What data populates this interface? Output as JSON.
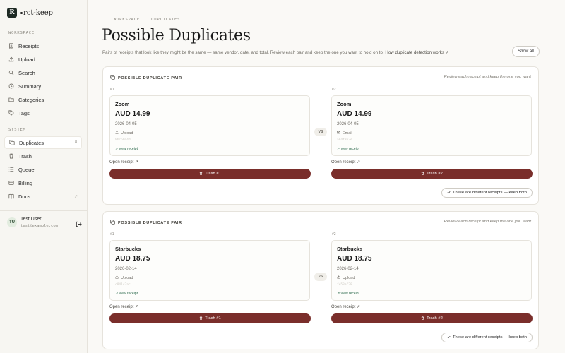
{
  "app": {
    "logo_letter": "R",
    "name": "rct-keep"
  },
  "sidebar": {
    "workspace_label": "WORKSPACE",
    "system_label": "SYSTEM",
    "workspace_items": [
      {
        "label": "Receipts",
        "icon": "receipt-icon"
      },
      {
        "label": "Upload",
        "icon": "upload-icon"
      },
      {
        "label": "Search",
        "icon": "search-icon"
      },
      {
        "label": "Summary",
        "icon": "clock-icon"
      },
      {
        "label": "Categories",
        "icon": "folder-icon"
      },
      {
        "label": "Tags",
        "icon": "tag-icon"
      }
    ],
    "system_items": [
      {
        "label": "Duplicates",
        "icon": "copy-icon",
        "badge": "8",
        "active": true
      },
      {
        "label": "Trash",
        "icon": "trash-icon"
      },
      {
        "label": "Queue",
        "icon": "list-icon"
      },
      {
        "label": "Billing",
        "icon": "card-icon"
      },
      {
        "label": "Docs",
        "icon": "book-icon",
        "external": "↗"
      }
    ],
    "user": {
      "initials": "TU",
      "name": "Test User",
      "email": "test@example.com"
    }
  },
  "breadcrumb": {
    "section": "WORKSPACE",
    "separator": "·",
    "page": "DUPLICATES"
  },
  "page": {
    "title": "Possible Duplicates",
    "description": "Pairs of receipts that look like they might be the same — same vendor, date, and total. Review each pair and keep the one you want to hold on to.",
    "description_link": "How duplicate detection works",
    "show_all": "Show all"
  },
  "pairs": [
    {
      "header": "POSSIBLE DUPLICATE PAIR",
      "hint": "Review each receipt and keep the one you want",
      "vs": "VS",
      "keep_both": "These are different receipts — keep both",
      "left": {
        "index": "#1",
        "vendor": "Zoom",
        "amount": "AUD 14.99",
        "date": "2026-04-05",
        "source": "Upload",
        "hash": "9bc5044d...",
        "view": "↗ view receipt",
        "open": "Open receipt",
        "trash": "Trash #1"
      },
      "right": {
        "index": "#2",
        "vendor": "Zoom",
        "amount": "AUD 14.99",
        "date": "2026-04-05",
        "source": "Email",
        "hash": "a84f3b2e...",
        "view": "↗ view receipt",
        "open": "Open receipt",
        "trash": "Trash #2"
      }
    },
    {
      "header": "POSSIBLE DUPLICATE PAIR",
      "hint": "Review each receipt and keep the one you want",
      "vs": "VS",
      "keep_both": "These are different receipts — keep both",
      "left": {
        "index": "#1",
        "vendor": "Starbucks",
        "amount": "AUD 18.75",
        "date": "2026-02-14",
        "source": "Upload",
        "hash": "c841c3ac...",
        "view": "↗ view receipt",
        "open": "Open receipt",
        "trash": "Trash #1"
      },
      "right": {
        "index": "#2",
        "vendor": "Starbucks",
        "amount": "AUD 18.75",
        "date": "2026-02-14",
        "source": "Upload",
        "hash": "fe53af28...",
        "view": "↗ view receipt",
        "open": "Open receipt",
        "trash": "Trash #2"
      }
    }
  ]
}
